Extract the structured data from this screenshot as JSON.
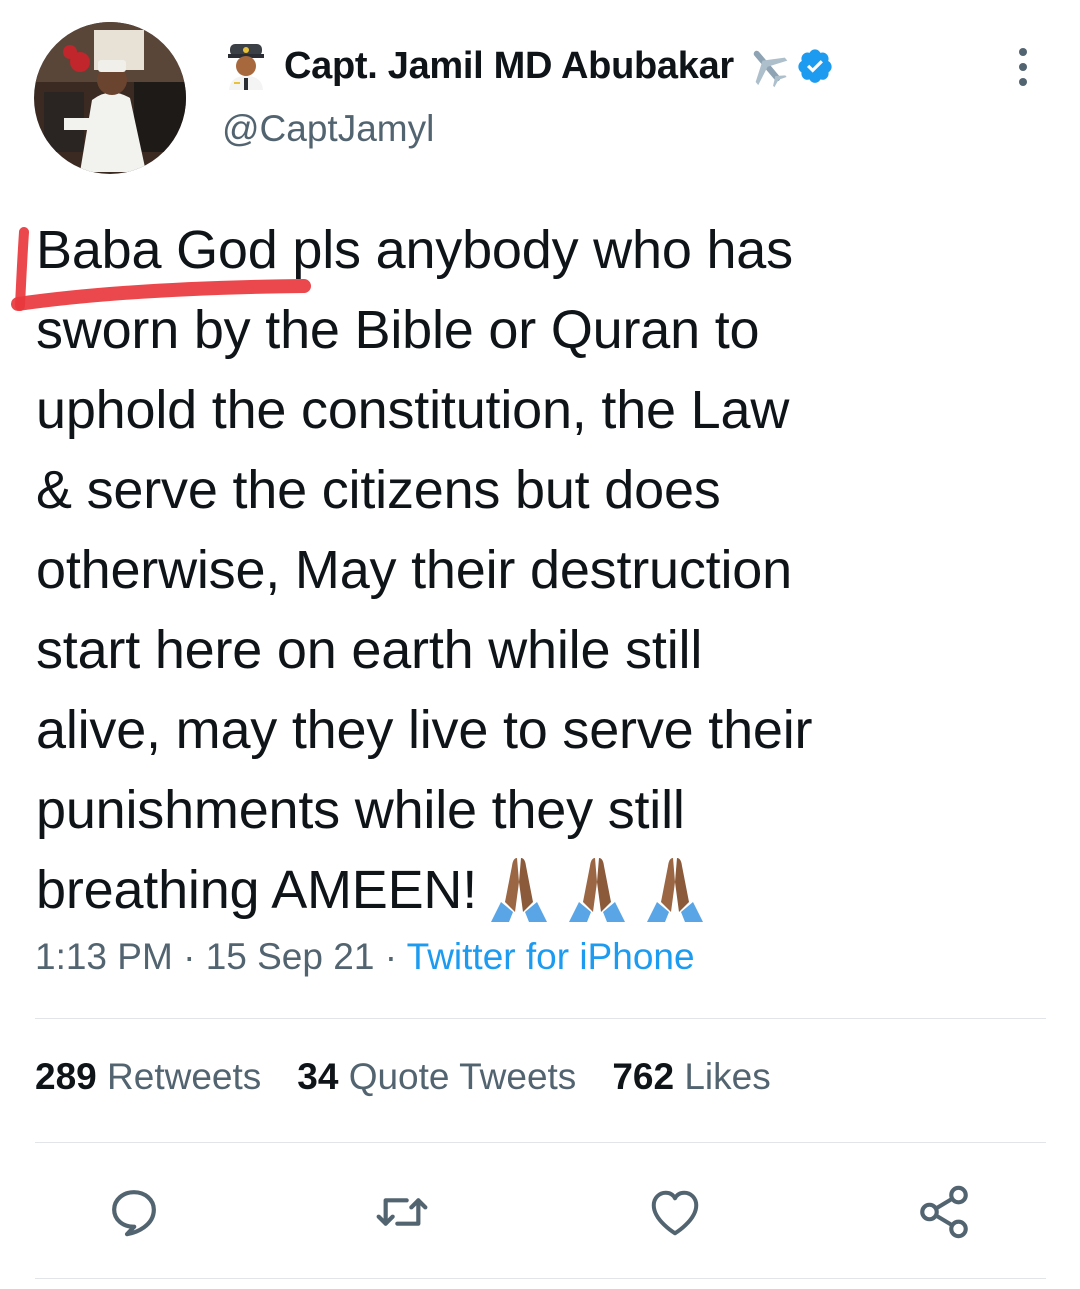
{
  "author": {
    "display_name": "Capt. Jamil MD Abubakar",
    "handle": "@CaptJamyl",
    "verified": true,
    "avatar": "profile-photo",
    "name_emojis": [
      "pilot-emoji",
      "airplane-emoji"
    ]
  },
  "tweet": {
    "lines": [
      "Baba God pls anybody who has",
      "sworn by the Bible or Quran to",
      "uphold the constitution, the Law",
      "& serve the citizens but does",
      "otherwise, May their destruction",
      "start here on earth while still",
      "alive, may they live to serve their",
      "punishments while they still",
      "breathing AMEEN!"
    ],
    "trailing_emojis": [
      "folded-hands-emoji",
      "folded-hands-emoji",
      "folded-hands-emoji"
    ]
  },
  "meta": {
    "time": "1:13 PM",
    "separator": "·",
    "date": "15 Sep 21",
    "source": "Twitter for iPhone"
  },
  "stats": {
    "retweets": {
      "count": "289",
      "label": "Retweets"
    },
    "quotes": {
      "count": "34",
      "label": "Quote Tweets"
    },
    "likes": {
      "count": "762",
      "label": "Likes"
    }
  },
  "actions": [
    "reply-icon",
    "retweet-icon",
    "like-icon",
    "share-icon"
  ],
  "colors": {
    "text": "#0f1419",
    "secondary": "#536471",
    "link": "#1d9bf0",
    "verified": "#1d9bf0",
    "annotation_marker": "#e8383d"
  }
}
